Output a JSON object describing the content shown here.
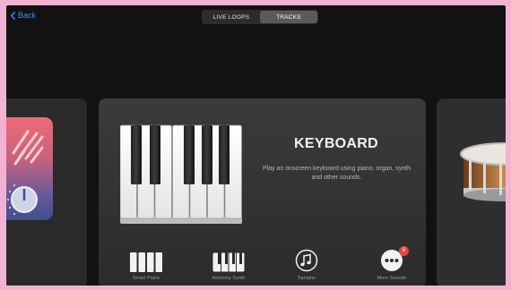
{
  "nav": {
    "back_label": "Back"
  },
  "tabs": [
    {
      "label": "LIVE LOOPS",
      "active": false
    },
    {
      "label": "TRACKS",
      "active": true
    }
  ],
  "main_card": {
    "title": "KEYBOARD",
    "description": "Play an onscreen keyboard using piano, organ, synth and other sounds."
  },
  "sounds": [
    {
      "label": "Smart Piano",
      "icon": "smart-piano-icon"
    },
    {
      "label": "Alchemy Synth",
      "icon": "alchemy-synth-icon"
    },
    {
      "label": "Sampler",
      "icon": "sampler-icon"
    },
    {
      "label": "More Sounds",
      "icon": "more-sounds-icon",
      "badge": "8"
    }
  ],
  "colors": {
    "accent": "#3a8ef0",
    "badge": "#e8453c",
    "background": "#121212"
  }
}
